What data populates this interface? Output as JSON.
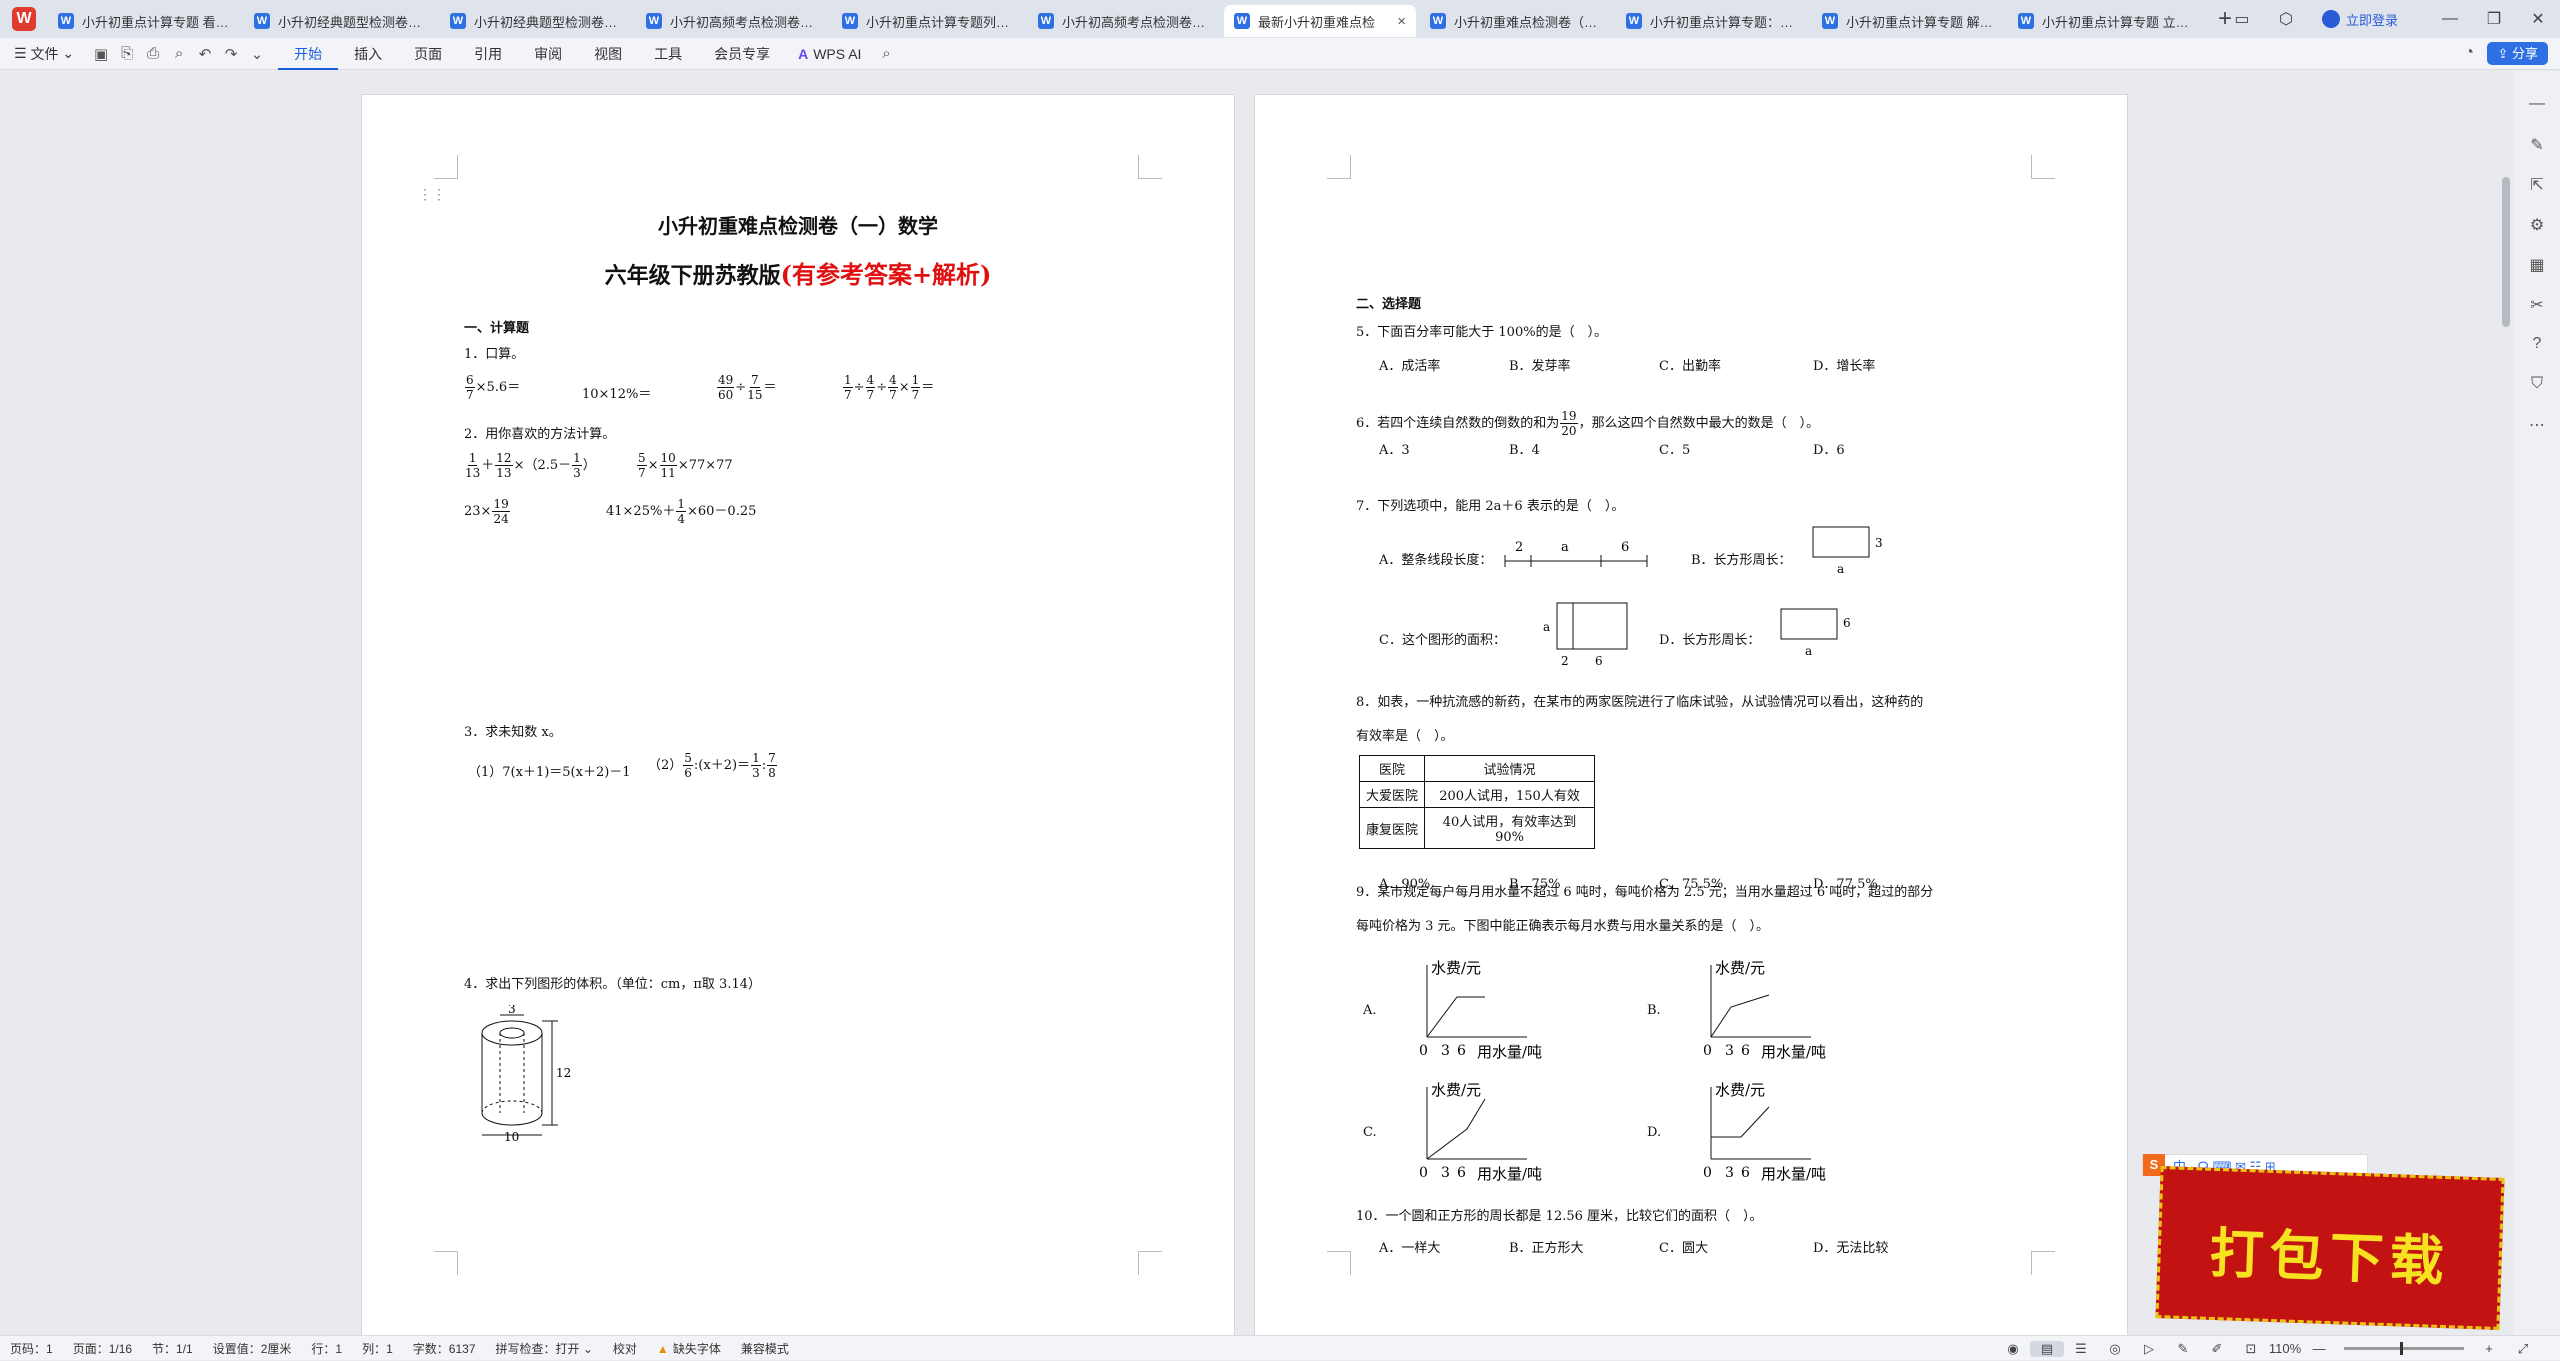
{
  "tabs": [
    {
      "label": "小升初重点计算专题 看图列",
      "active": false
    },
    {
      "label": "小升初经典题型检测卷（一）",
      "active": false
    },
    {
      "label": "小升初经典题型检测卷（二）",
      "active": false
    },
    {
      "label": "小升初高频考点检测卷（一）",
      "active": false
    },
    {
      "label": "小升初重点计算专题列式计算",
      "active": false
    },
    {
      "label": "小升初高频考点检测卷二（含",
      "active": false
    },
    {
      "label": "最新小升初重难点检",
      "active": true
    },
    {
      "label": "小升初重难点检测卷（二合",
      "active": false
    },
    {
      "label": "小升初重点计算专题：平面图",
      "active": false
    },
    {
      "label": "小升初重点计算专题 解方程",
      "active": false
    },
    {
      "label": "小升初重点计算专题 立体图",
      "active": false
    }
  ],
  "tabbar": {
    "login": "立即登录"
  },
  "toolbar": {
    "file": "文件",
    "ribbon": [
      "开始",
      "插入",
      "页面",
      "引用",
      "审阅",
      "视图",
      "工具",
      "会员专享"
    ],
    "ai": "WPS AI",
    "share": "分享"
  },
  "page1": {
    "title": "小升初重难点检测卷（一）数学",
    "subtitle_main": "六年级下册苏教版",
    "subtitle_red": "(有参考答案+解析)",
    "sec1": "一、计算题",
    "q1": "1．口算。",
    "q1_items": [
      "×5.6＝",
      "10×12%＝",
      "÷＝",
      "÷÷×＝"
    ],
    "q2": "2．用你喜欢的方法计算。",
    "q2_items": [
      "×（2.5－）",
      "××77×77",
      "23×",
      "41×25%＋×60－0.25"
    ],
    "q3": "3．求未知数 x。",
    "q3_items": [
      "（1）7(x＋1)＝5(x＋2)－1",
      "（2）:(x＋2)＝:"
    ],
    "q4": "4．求出下列图形的体积。（单位：cm，π取 3.14）",
    "q4_labels": [
      "3",
      "12",
      "10"
    ]
  },
  "page2": {
    "sec2": "二、选择题",
    "q5": "5．下面百分率可能大于 100%的是（　）。",
    "q5_opts": [
      "A．成活率",
      "B．发芽率",
      "C．出勤率",
      "D．增长率"
    ],
    "q6": "6．若四个连续自然数的倒数的和为",
    "q6b": "，那么这四个自然数中最大的数是（　）。",
    "q6_opts": [
      "A．3",
      "B．4",
      "C．5",
      "D．6"
    ],
    "q7": "7．下列选项中，能用 2a＋6 表示的是（　）。",
    "q7_a": "A．整条线段长度：",
    "q7_b": "B．长方形周长：",
    "q7_c": "C．这个图形的面积：",
    "q7_d": "D．长方形周长：",
    "q8": "8．如表，一种抗流感的新药，在某市的两家医院进行了临床试验，从试验情况可以看出，这种药的",
    "q8b": "有效率是（　）。",
    "table": {
      "h1": "医院",
      "h2": "试验情况",
      "r1a": "大爱医院",
      "r1b": "200人试用，150人有效",
      "r2a": "康复医院",
      "r2b": "40人试用，有效率达到90%"
    },
    "q8_opts": [
      "A．90%",
      "B．75%",
      "C．75.5%",
      "D．77.5%"
    ],
    "q9": "9．某市规定每户每月用水量不超过 6 吨时，每吨价格为 2.5 元；当用水量超过 6 吨时，超过的部分",
    "q9b": "每吨价格为 3 元。下图中能正确表示每月水费与用水量关系的是（　）。",
    "graph_y": "水费/元",
    "graph_x": "用水量/吨",
    "graph_letters": [
      "A.",
      "B.",
      "C.",
      "D."
    ],
    "q10": "10．一个圆和正方形的周长都是 12.56 厘米，比较它们的面积（　）。",
    "q10_opts": [
      "A．一样大",
      "B．正方形大",
      "C．圆大",
      "D．无法比较"
    ]
  },
  "promo": "打包下载",
  "status": {
    "page": "页码：1",
    "pages": "页面：1/16",
    "section": "节：1/1",
    "setting": "设置值：2厘米",
    "row": "行：1",
    "col": "列：1",
    "words": "字数：6137",
    "spell": "拼写检查：打开",
    "proof": "校对",
    "missing_font": "缺失字体",
    "compat": "兼容模式",
    "zoom": "110%"
  }
}
